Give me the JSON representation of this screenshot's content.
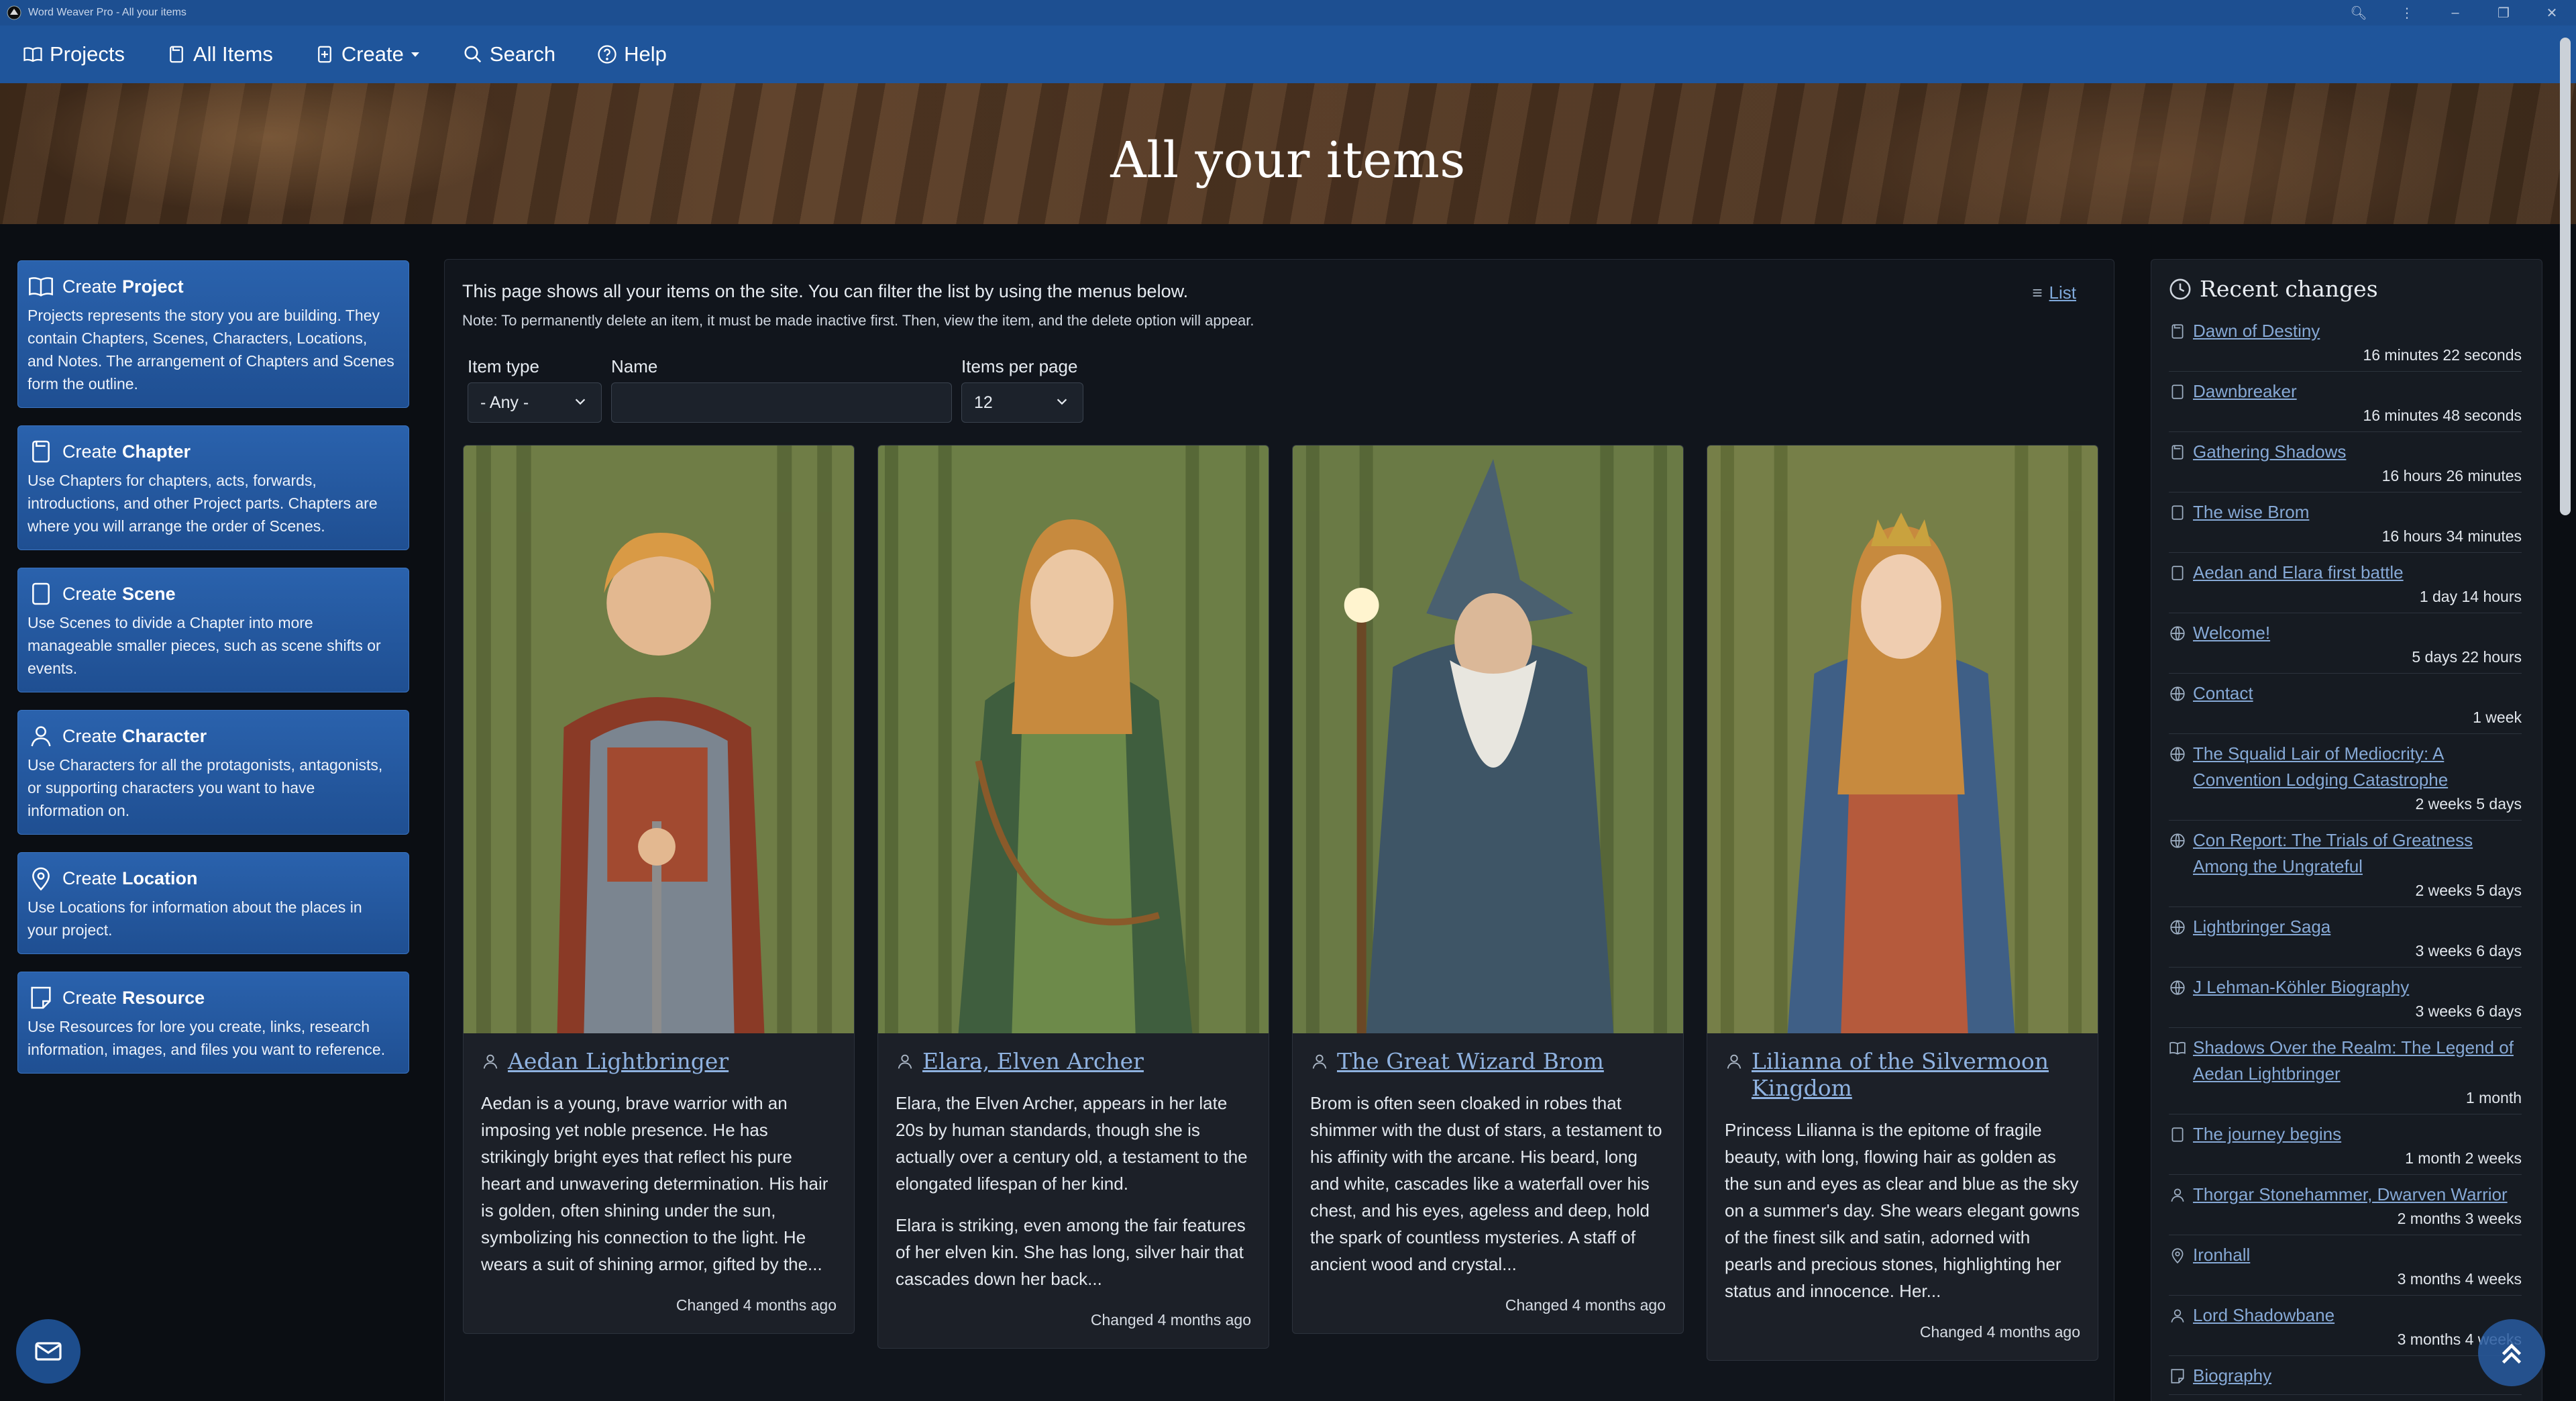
{
  "window": {
    "title": "Word Weaver Pro - All your items"
  },
  "nav": {
    "projects": "Projects",
    "all_items": "All Items",
    "create": "Create",
    "search": "Search",
    "help": "Help"
  },
  "hero": {
    "title": "All your items"
  },
  "create_cards": [
    {
      "prefix": "Create",
      "name": "Project",
      "icon": "book-icon",
      "desc": "Projects represents the story you are building. They contain Chapters, Scenes, Characters, Locations, and Notes. The arrangement of Chapters and Scenes form the outline."
    },
    {
      "prefix": "Create",
      "name": "Chapter",
      "icon": "chapter-icon",
      "desc": "Use Chapters for chapters, acts, forwards, introductions, and other Project parts. Chapters are where you will arrange the order of Scenes."
    },
    {
      "prefix": "Create",
      "name": "Scene",
      "icon": "scene-icon",
      "desc": "Use Scenes to divide a Chapter into more manageable smaller pieces, such as scene shifts or events."
    },
    {
      "prefix": "Create",
      "name": "Character",
      "icon": "person-icon",
      "desc": "Use Characters for all the protagonists, antagonists, or supporting characters you want to have information on."
    },
    {
      "prefix": "Create",
      "name": "Location",
      "icon": "pin-icon",
      "desc": "Use Locations for information about the places in your project."
    },
    {
      "prefix": "Create",
      "name": "Resource",
      "icon": "note-icon",
      "desc": "Use Resources for lore you create, links, research information, images, and files you want to reference."
    }
  ],
  "main": {
    "intro": "This page shows all your items on the site. You can filter the list by using the menus below.",
    "note": "Note: To permanently delete an item, it must be made inactive first. Then, view the item, and the delete option will appear.",
    "list_toggle": "List",
    "filters": {
      "item_type_label": "Item type",
      "item_type_value": "- Any -",
      "name_label": "Name",
      "name_value": "",
      "per_page_label": "Items per page",
      "per_page_value": "12"
    }
  },
  "items": [
    {
      "title": "Aedan Lightbringer",
      "paragraphs": [
        "Aedan is a young, brave warrior with an imposing yet noble presence. He has strikingly bright eyes that reflect his pure heart and unwavering determination. His hair is golden, often shining under the sun, symbolizing his connection to the light. He wears a suit of shining armor, gifted by the..."
      ],
      "changed": "Changed 4 months ago"
    },
    {
      "title": "Elara, Elven Archer",
      "paragraphs": [
        "Elara, the Elven Archer, appears in her late 20s by human standards, though she is actually over a century old, a testament to the elongated lifespan of her kind.",
        "Elara is striking, even among the fair features of her elven kin. She has long, silver hair that cascades down her back..."
      ],
      "changed": "Changed 4 months ago"
    },
    {
      "title": "The Great Wizard Brom",
      "paragraphs": [
        "Brom is often seen cloaked in robes that shimmer with the dust of stars, a testament to his affinity with the arcane. His beard, long and white, cascades like a waterfall over his chest, and his eyes, ageless and deep, hold the spark of countless mysteries. A staff of ancient wood and crystal..."
      ],
      "changed": "Changed 4 months ago"
    },
    {
      "title": "Lilianna of the Silvermoon Kingdom",
      "paragraphs": [
        "Princess Lilianna is the epitome of fragile beauty, with long, flowing hair as golden as the sun and eyes as clear and blue as the sky on a summer's day. She wears elegant gowns of the finest silk and satin, adorned with pearls and precious stones, highlighting her status and innocence. Her..."
      ],
      "changed": "Changed 4 months ago"
    }
  ],
  "recent": {
    "title": "Recent changes",
    "items": [
      {
        "label": "Dawn of Destiny",
        "time": "16 minutes 22 seconds",
        "icon": "chapter-icon"
      },
      {
        "label": "Dawnbreaker",
        "time": "16 minutes 48 seconds",
        "icon": "scene-icon"
      },
      {
        "label": "Gathering Shadows",
        "time": "16 hours 26 minutes",
        "icon": "chapter-icon"
      },
      {
        "label": "The wise Brom",
        "time": "16 hours 34 minutes",
        "icon": "scene-icon"
      },
      {
        "label": "Aedan and Elara first battle",
        "time": "1 day 14 hours",
        "icon": "scene-icon"
      },
      {
        "label": "Welcome!",
        "time": "5 days 22 hours",
        "icon": "globe-icon"
      },
      {
        "label": "Contact",
        "time": "1 week",
        "icon": "globe-icon"
      },
      {
        "label": "The Squalid Lair of Mediocrity: A Convention Lodging Catastrophe",
        "time": "2 weeks 5 days",
        "icon": "globe-icon"
      },
      {
        "label": "Con Report: The Trials of Greatness Among the Ungrateful",
        "time": "2 weeks 5 days",
        "icon": "globe-icon"
      },
      {
        "label": "Lightbringer Saga",
        "time": "3 weeks 6 days",
        "icon": "globe-icon"
      },
      {
        "label": "J Lehman-Köhler Biography",
        "time": "3 weeks 6 days",
        "icon": "globe-icon"
      },
      {
        "label": "Shadows Over the Realm: The Legend of Aedan Lightbringer",
        "time": "1 month",
        "icon": "book-icon"
      },
      {
        "label": "The journey begins",
        "time": "1 month 2 weeks",
        "icon": "scene-icon"
      },
      {
        "label": "Thorgar Stonehammer, Dwarven Warrior",
        "time": "2 months 3 weeks",
        "icon": "person-icon"
      },
      {
        "label": "Ironhall",
        "time": "3 months 4 weeks",
        "icon": "pin-icon"
      },
      {
        "label": "Lord Shadowbane",
        "time": "3 months 4 weeks",
        "icon": "person-icon"
      },
      {
        "label": "Biography",
        "time": "",
        "icon": "note-icon"
      }
    ]
  }
}
